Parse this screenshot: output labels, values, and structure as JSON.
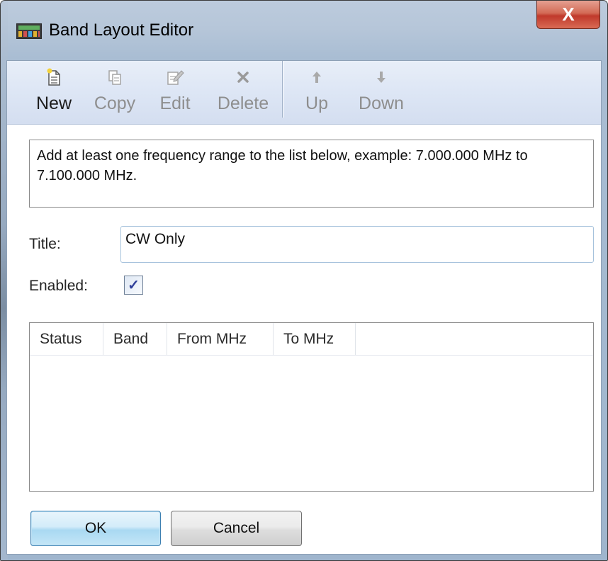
{
  "window": {
    "title": "Band Layout Editor",
    "close_symbol": "X"
  },
  "toolbar": {
    "items": [
      {
        "label": "New",
        "icon": "new-document-icon",
        "enabled": true
      },
      {
        "label": "Copy",
        "icon": "copy-icon",
        "enabled": false
      },
      {
        "label": "Edit",
        "icon": "edit-icon",
        "enabled": false
      },
      {
        "label": "Delete",
        "icon": "delete-icon",
        "enabled": false
      },
      {
        "label": "Up",
        "icon": "arrow-up-icon",
        "enabled": false
      },
      {
        "label": "Down",
        "icon": "arrow-down-icon",
        "enabled": false
      }
    ]
  },
  "info": {
    "text": "Add at least one frequency range to the list below, example: 7.000.000 MHz to 7.100.000 MHz."
  },
  "form": {
    "title_label": "Title:",
    "title_value": "CW Only",
    "enabled_label": "Enabled:",
    "enabled_checked": true
  },
  "table": {
    "columns": [
      "Status",
      "Band",
      "From MHz",
      "To MHz"
    ],
    "rows": []
  },
  "buttons": {
    "ok": "OK",
    "cancel": "Cancel"
  },
  "colors": {
    "toolbar_bg": "#dde6f5",
    "close_button": "#c0392b",
    "ok_button": "#a9d9f2",
    "checkbox_mark": "#2f3f9a"
  }
}
